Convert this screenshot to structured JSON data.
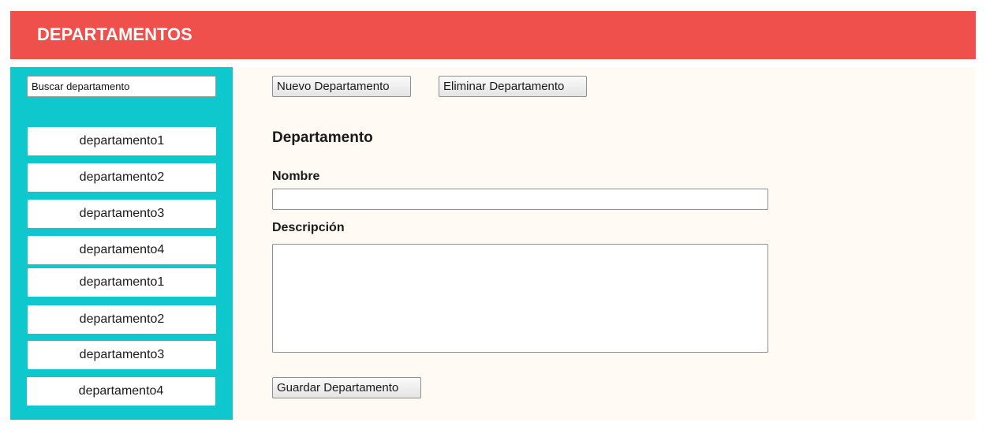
{
  "header": {
    "title": "DEPARTAMENTOS"
  },
  "sidebar": {
    "search_placeholder": "Buscar departamento",
    "items": [
      {
        "label": "departamento1"
      },
      {
        "label": "departamento2"
      },
      {
        "label": "departamento3"
      },
      {
        "label": "departamento4"
      },
      {
        "label": "departamento1"
      },
      {
        "label": "departamento2"
      },
      {
        "label": "departamento3"
      },
      {
        "label": "departamento4"
      }
    ]
  },
  "toolbar": {
    "new_label": "Nuevo Departamento",
    "delete_label": "Eliminar Departamento"
  },
  "form": {
    "section_title": "Departamento",
    "name_label": "Nombre",
    "name_value": "",
    "description_label": "Descripción",
    "description_value": "",
    "save_label": "Guardar Departamento"
  },
  "colors": {
    "header_bg": "#ef504b",
    "sidebar_bg": "#0fc8ce",
    "main_bg": "#fffaf3"
  }
}
